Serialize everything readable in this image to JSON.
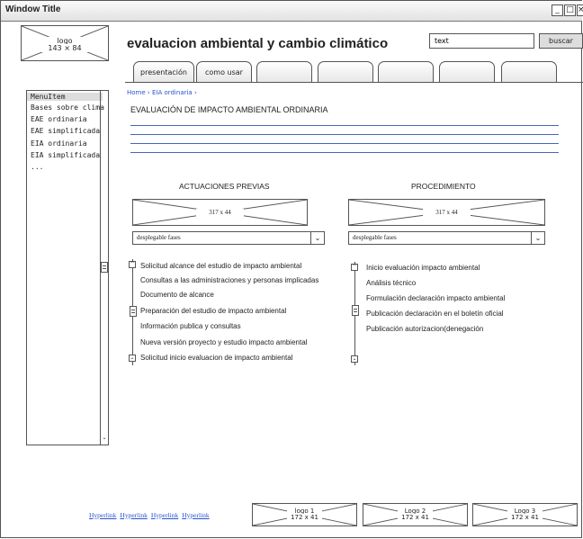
{
  "window": {
    "title": "Window Title"
  },
  "header": {
    "logo": {
      "label": "logo",
      "size": "143 × 84"
    },
    "title": "evaluacion ambiental y cambio climático",
    "search": {
      "value": "text",
      "button": "buscar"
    }
  },
  "tabs": [
    {
      "label": "presentación"
    },
    {
      "label": "como usar"
    },
    {
      "label": ""
    },
    {
      "label": ""
    },
    {
      "label": ""
    },
    {
      "label": ""
    },
    {
      "label": ""
    }
  ],
  "sidebar": {
    "items": [
      {
        "label": "MenuItem"
      },
      {
        "label": "Bases sobre clima"
      },
      {
        "label": "EAE ordinaria"
      },
      {
        "label": "EAE simplificada"
      },
      {
        "label": "EIA ordinaria"
      },
      {
        "label": "EIA simplificada"
      },
      {
        "label": "..."
      }
    ]
  },
  "breadcrumb": {
    "home": "Home",
    "sep": "›",
    "current": "EIA ordinaria"
  },
  "page_heading": "EVALUACIÓN DE IMPACTO AMBIENTAL ORDINARIA",
  "sections": {
    "left": {
      "title": "ACTUACIONES PREVIAS",
      "image_size": "317 x 44",
      "dropdown": "desplegable fases",
      "items": [
        "Solicitud alcance del estudio de impacto ambiental",
        "Consultas a las administraciones y personas implicadas",
        "Documento de alcance",
        "Preparación del estudio de impacto ambiental",
        "Información publica y consultas",
        "Nueva versión proyecto y estudio impacto ambiental",
        "Solicitud inicio evaluacion de impacto ambiental"
      ]
    },
    "right": {
      "title": "PROCEDIMIENTO",
      "image_size": "317 x 44",
      "dropdown": "desplegable fases",
      "items": [
        "Inicio evaluación impacto ambiental",
        "Análisis técnico",
        "Formulación declaración impacto ambiental",
        "Publicación declaración en el boletín oficial",
        "Publicación autorizacion(denegación"
      ]
    }
  },
  "footer": {
    "links": [
      "Hyperlink",
      "Hyperlink",
      "Hyperlink",
      "Hyperlink"
    ],
    "logos": [
      {
        "label": "logo 1",
        "size": "172 x 41"
      },
      {
        "label": "Logo 2",
        "size": "172 x 41"
      },
      {
        "label": "Logo 3",
        "size": "172 x 41"
      }
    ]
  }
}
